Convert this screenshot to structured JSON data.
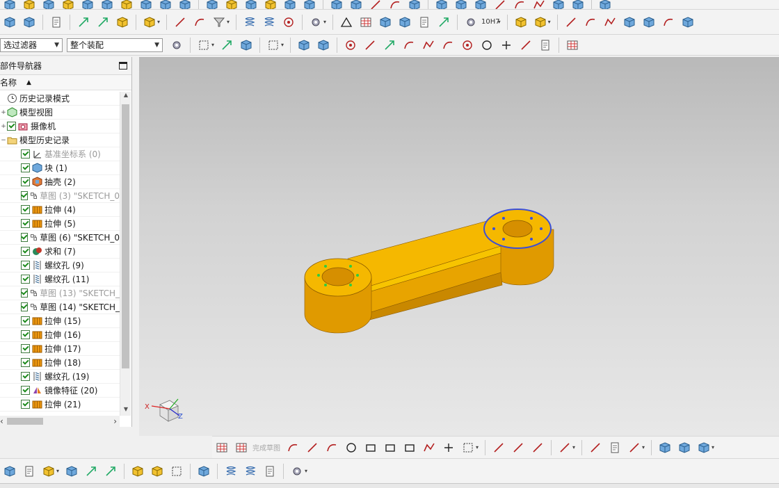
{
  "filter_bar": {
    "type_filter": {
      "value": "选过滤器"
    },
    "assembly_scope": {
      "value": "整个装配"
    }
  },
  "navigator": {
    "title": "部件导航器",
    "column_name": "名称",
    "items": [
      {
        "label": "历史记录模式",
        "icon": "clock-icon",
        "level": 0,
        "checked": false,
        "grey": false,
        "expander": ""
      },
      {
        "label": "模型视图",
        "icon": "model-view-icon",
        "level": 0,
        "checked": false,
        "grey": false,
        "expander": "+"
      },
      {
        "label": "摄像机",
        "icon": "camera-icon",
        "level": 0,
        "checked": true,
        "grey": false,
        "expander": "+"
      },
      {
        "label": "模型历史记录",
        "icon": "folder-icon",
        "level": 0,
        "checked": false,
        "grey": false,
        "expander": "-"
      },
      {
        "label": "基准坐标系 (0)",
        "icon": "datum-csys-icon",
        "level": 1,
        "checked": true,
        "grey": true
      },
      {
        "label": "块 (1)",
        "icon": "block-icon",
        "level": 1,
        "checked": true,
        "grey": false
      },
      {
        "label": "抽壳 (2)",
        "icon": "shell-icon",
        "level": 1,
        "checked": true,
        "grey": false
      },
      {
        "label": "草图 (3) \"SKETCH_0",
        "icon": "sketch-icon",
        "level": 1,
        "checked": true,
        "grey": true
      },
      {
        "label": "拉伸 (4)",
        "icon": "extrude-icon",
        "level": 1,
        "checked": true,
        "grey": false
      },
      {
        "label": "拉伸 (5)",
        "icon": "extrude-icon",
        "level": 1,
        "checked": true,
        "grey": false
      },
      {
        "label": "草图 (6) \"SKETCH_0",
        "icon": "sketch-icon",
        "level": 1,
        "checked": true,
        "grey": false
      },
      {
        "label": "求和 (7)",
        "icon": "unite-icon",
        "level": 1,
        "checked": true,
        "grey": false
      },
      {
        "label": "螺纹孔 (9)",
        "icon": "threaded-hole-icon",
        "level": 1,
        "checked": true,
        "grey": false
      },
      {
        "label": "螺纹孔 (11)",
        "icon": "threaded-hole-icon",
        "level": 1,
        "checked": true,
        "grey": false
      },
      {
        "label": "草图 (13) \"SKETCH_",
        "icon": "sketch-icon",
        "level": 1,
        "checked": true,
        "grey": true
      },
      {
        "label": "草图 (14) \"SKETCH_",
        "icon": "sketch-icon",
        "level": 1,
        "checked": true,
        "grey": false
      },
      {
        "label": "拉伸 (15)",
        "icon": "extrude-icon",
        "level": 1,
        "checked": true,
        "grey": false
      },
      {
        "label": "拉伸 (16)",
        "icon": "extrude-icon",
        "level": 1,
        "checked": true,
        "grey": false
      },
      {
        "label": "拉伸 (17)",
        "icon": "extrude-icon",
        "level": 1,
        "checked": true,
        "grey": false
      },
      {
        "label": "拉伸 (18)",
        "icon": "extrude-icon",
        "level": 1,
        "checked": true,
        "grey": false
      },
      {
        "label": "螺纹孔 (19)",
        "icon": "threaded-hole-icon",
        "level": 1,
        "checked": true,
        "grey": false
      },
      {
        "label": "镜像特征 (20)",
        "icon": "mirror-feature-icon",
        "level": 1,
        "checked": true,
        "grey": false
      },
      {
        "label": "拉伸 (21)",
        "icon": "extrude-icon",
        "level": 1,
        "checked": true,
        "grey": false
      }
    ]
  },
  "toolbar": {
    "tolerance_label": "10H7"
  },
  "sketch_toolbar": {
    "finish_sketch_label": "完成草图"
  },
  "viewport": {
    "triad_labels": {
      "x": "X",
      "z": "Z"
    }
  },
  "colors": {
    "model_face": "#f5b800",
    "model_side": "#e09a00",
    "selection_edge": "#3b4fd8",
    "hole_points": "#2ecc40"
  }
}
